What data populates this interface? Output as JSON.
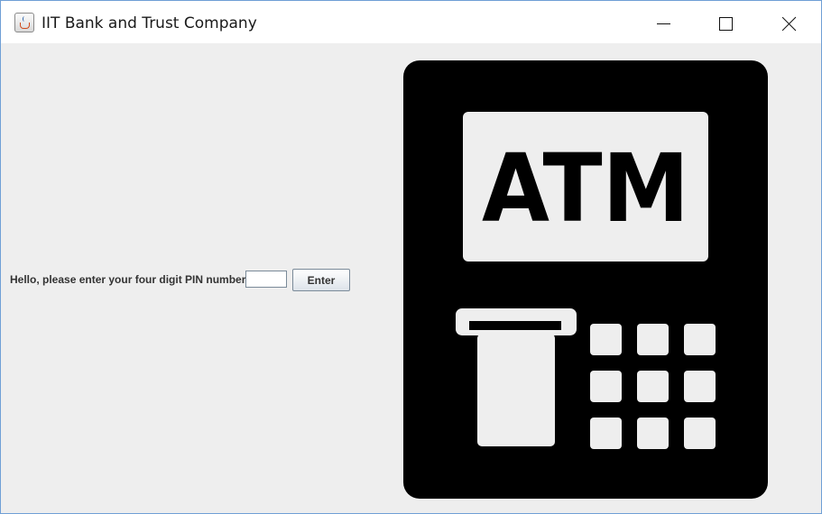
{
  "window": {
    "title": "IIT Bank and Trust Company",
    "app_icon": "java-cup-icon",
    "controls": [
      "minimize-icon",
      "maximize-icon",
      "close-icon"
    ]
  },
  "login": {
    "prompt": "Hello, please enter your four digit PIN number",
    "pin_value": "",
    "enter_label": "Enter"
  },
  "atm_image": {
    "screen_text": "ATM",
    "keypad_keys": 9,
    "colors": {
      "body": "#000000",
      "screen": "#eeeeee"
    }
  }
}
